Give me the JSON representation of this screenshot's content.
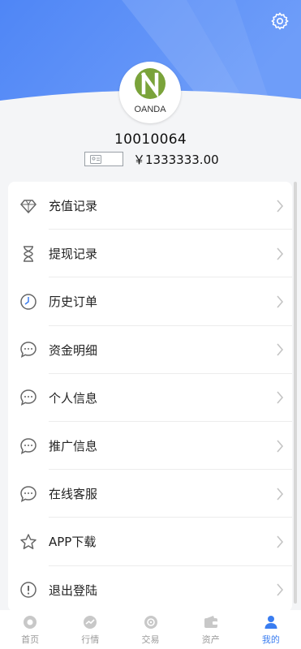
{
  "header": {
    "settings_icon": "gear-icon",
    "accent_color": "#5b8ef7"
  },
  "profile": {
    "logo_text": "OANDA",
    "user_id": "10010064",
    "balance": "￥1333333.00"
  },
  "menu": {
    "items": [
      {
        "icon": "diamond-icon",
        "label": "充值记录"
      },
      {
        "icon": "hourglass-icon",
        "label": "提现记录"
      },
      {
        "icon": "clock-icon",
        "label": "历史订单"
      },
      {
        "icon": "chat-bubble-icon",
        "label": "资金明细"
      },
      {
        "icon": "chat-bubble-icon",
        "label": "个人信息"
      },
      {
        "icon": "chat-bubble-icon",
        "label": "推广信息"
      },
      {
        "icon": "chat-bubble-icon",
        "label": "在线客服"
      },
      {
        "icon": "star-icon",
        "label": "APP下载"
      },
      {
        "icon": "exclamation-circle-icon",
        "label": "退出登陆"
      }
    ]
  },
  "tabbar": {
    "tabs": [
      {
        "icon": "home-icon",
        "label": "首页"
      },
      {
        "icon": "trend-icon",
        "label": "行情"
      },
      {
        "icon": "exchange-icon",
        "label": "交易"
      },
      {
        "icon": "wallet-icon",
        "label": "资产"
      },
      {
        "icon": "user-icon",
        "label": "我的"
      }
    ],
    "active_index": 4,
    "active_color": "#3a7df0",
    "inactive_color": "#9a9a9a"
  }
}
